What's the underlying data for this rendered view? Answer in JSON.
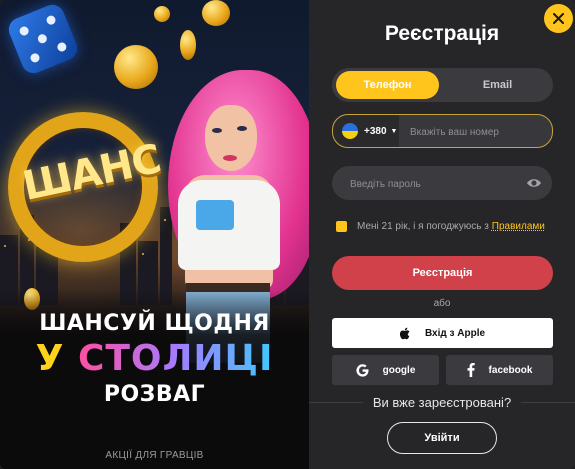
{
  "promo": {
    "logo_text": "ШАНС",
    "line1": "ШАНСУЙ ЩОДНЯ",
    "line2_part1": "У ",
    "line2_part2": "СТОЛИЦІ",
    "line3": "РОЗВАГ",
    "link": "АКЦІЇ ДЛЯ ГРАВЦІВ"
  },
  "form": {
    "title": "Реєстрація",
    "tabs": [
      {
        "label": "Телефон",
        "active": true
      },
      {
        "label": "Email",
        "active": false
      }
    ],
    "phone": {
      "country_code": "+380",
      "placeholder": "Вкажіть ваш номер",
      "value": ""
    },
    "password": {
      "placeholder": "Введіть пароль",
      "value": ""
    },
    "agree_text": "Мені 21 рік, і я погоджуюсь з",
    "rules_link": "Правилами",
    "register_button": "Реєстрація",
    "or_text": "або",
    "apple_button": "Вхід з Apple",
    "google_button": "google",
    "facebook_button": "facebook",
    "already_text": "Ви вже зареєстровані?",
    "login_button": "Увійти"
  },
  "icons": [
    "close-icon",
    "ukraine-flag-icon",
    "eye-icon",
    "apple-icon",
    "google-icon",
    "facebook-icon"
  ],
  "colors": {
    "accent": "#ffc51c",
    "register": "#d0414a",
    "panel": "#262628",
    "field": "#3b3b3f"
  }
}
